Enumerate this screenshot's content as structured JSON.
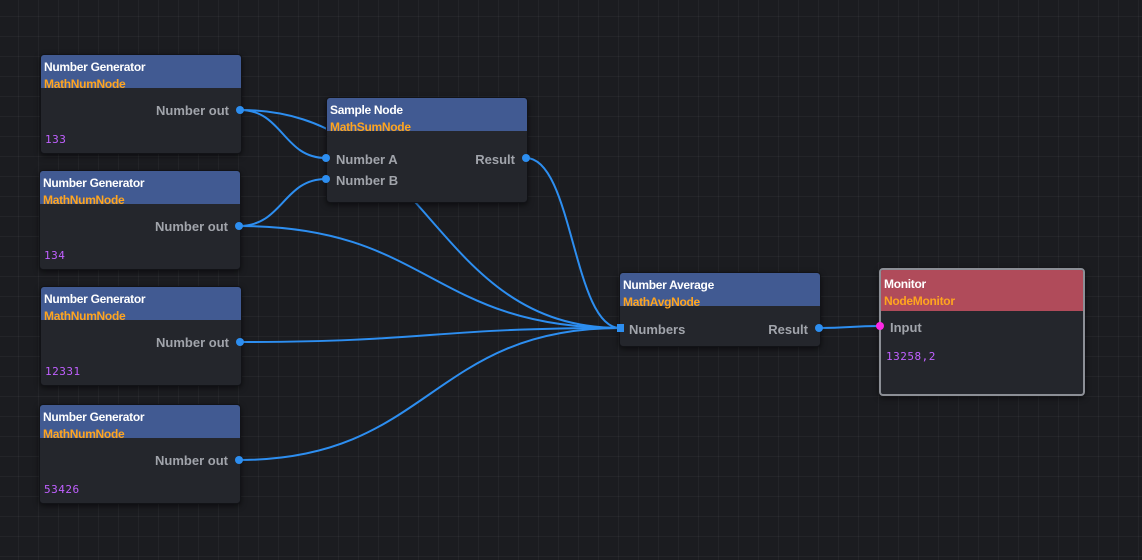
{
  "colors": {
    "wire": "#2d8ef0",
    "header_default": "#415a92",
    "header_monitor": "#b04b5a",
    "type_text": "#ffa51f",
    "value_text": "#c060ff",
    "input_port_monitor": "#ff28e6"
  },
  "nodes": {
    "gen1": {
      "title": "Number Generator",
      "type": "MathNumNode",
      "port_out": "Number out",
      "value": "133"
    },
    "gen2": {
      "title": "Number Generator",
      "type": "MathNumNode",
      "port_out": "Number out",
      "value": "134"
    },
    "gen3": {
      "title": "Number Generator",
      "type": "MathNumNode",
      "port_out": "Number out",
      "value": "12331"
    },
    "gen4": {
      "title": "Number Generator",
      "type": "MathNumNode",
      "port_out": "Number out",
      "value": "53426"
    },
    "sum": {
      "title": "Sample Node",
      "type": "MathSumNode",
      "port_in_a": "Number A",
      "port_in_b": "Number B",
      "port_out": "Result"
    },
    "avg": {
      "title": "Number Average",
      "type": "MathAvgNode",
      "port_in": "Numbers",
      "port_out": "Result"
    },
    "monitor": {
      "title": "Monitor",
      "type": "NodeMonitor",
      "port_in": "Input",
      "value": "13258,2"
    }
  }
}
